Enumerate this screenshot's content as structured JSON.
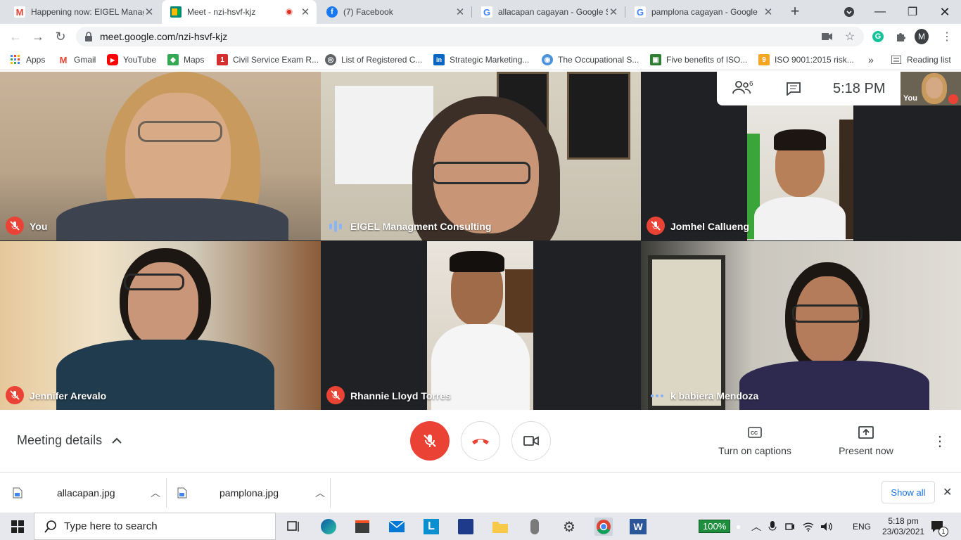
{
  "tabs": [
    {
      "title": "Happening now: EIGEL Manag",
      "icon": "gmail-icon"
    },
    {
      "title": "Meet - nzi-hsvf-kjz",
      "icon": "meet-icon",
      "active": true
    },
    {
      "title": "(7) Facebook",
      "icon": "facebook-icon"
    },
    {
      "title": "allacapan cagayan - Google S",
      "icon": "google-icon"
    },
    {
      "title": "pamplona cagayan - Google",
      "icon": "google-icon"
    }
  ],
  "address": {
    "url": "meet.google.com/nzi-hsvf-kjz",
    "profile_initial": "M"
  },
  "bookmarks": [
    {
      "label": "Apps"
    },
    {
      "label": "Gmail"
    },
    {
      "label": "YouTube"
    },
    {
      "label": "Maps"
    },
    {
      "label": "Civil Service Exam R..."
    },
    {
      "label": "List of Registered C..."
    },
    {
      "label": "Strategic Marketing..."
    },
    {
      "label": "The Occupational S..."
    },
    {
      "label": "Five benefits of ISO..."
    },
    {
      "label": "ISO 9001:2015 risk..."
    },
    {
      "label": "Reading list"
    }
  ],
  "meeting": {
    "participant_count": "6",
    "time": "5:18 PM",
    "self_label": "You",
    "tiles": [
      {
        "name": "You",
        "status": "muted"
      },
      {
        "name": "EIGEL Managment Consulting",
        "status": "speaking"
      },
      {
        "name": "Jomhel Callueng",
        "status": "muted"
      },
      {
        "name": "Jennifer Arevalo",
        "status": "muted"
      },
      {
        "name": "Rhannie Lloyd Torres",
        "status": "muted"
      },
      {
        "name": "k babiera Mendoza",
        "status": "active"
      }
    ]
  },
  "controls": {
    "meeting_details": "Meeting details",
    "captions": "Turn on captions",
    "present": "Present now"
  },
  "downloads": {
    "files": [
      "allacapan.jpg",
      "pamplona.jpg"
    ],
    "show_all": "Show all"
  },
  "taskbar": {
    "search_placeholder": "Type here to search",
    "battery": "100%",
    "language": "ENG",
    "time": "5:18 pm",
    "date": "23/03/2021",
    "notifications": "1"
  },
  "colors": {
    "accent": "#1a73e8",
    "danger": "#ea4335",
    "meet_bg": "#202124"
  }
}
